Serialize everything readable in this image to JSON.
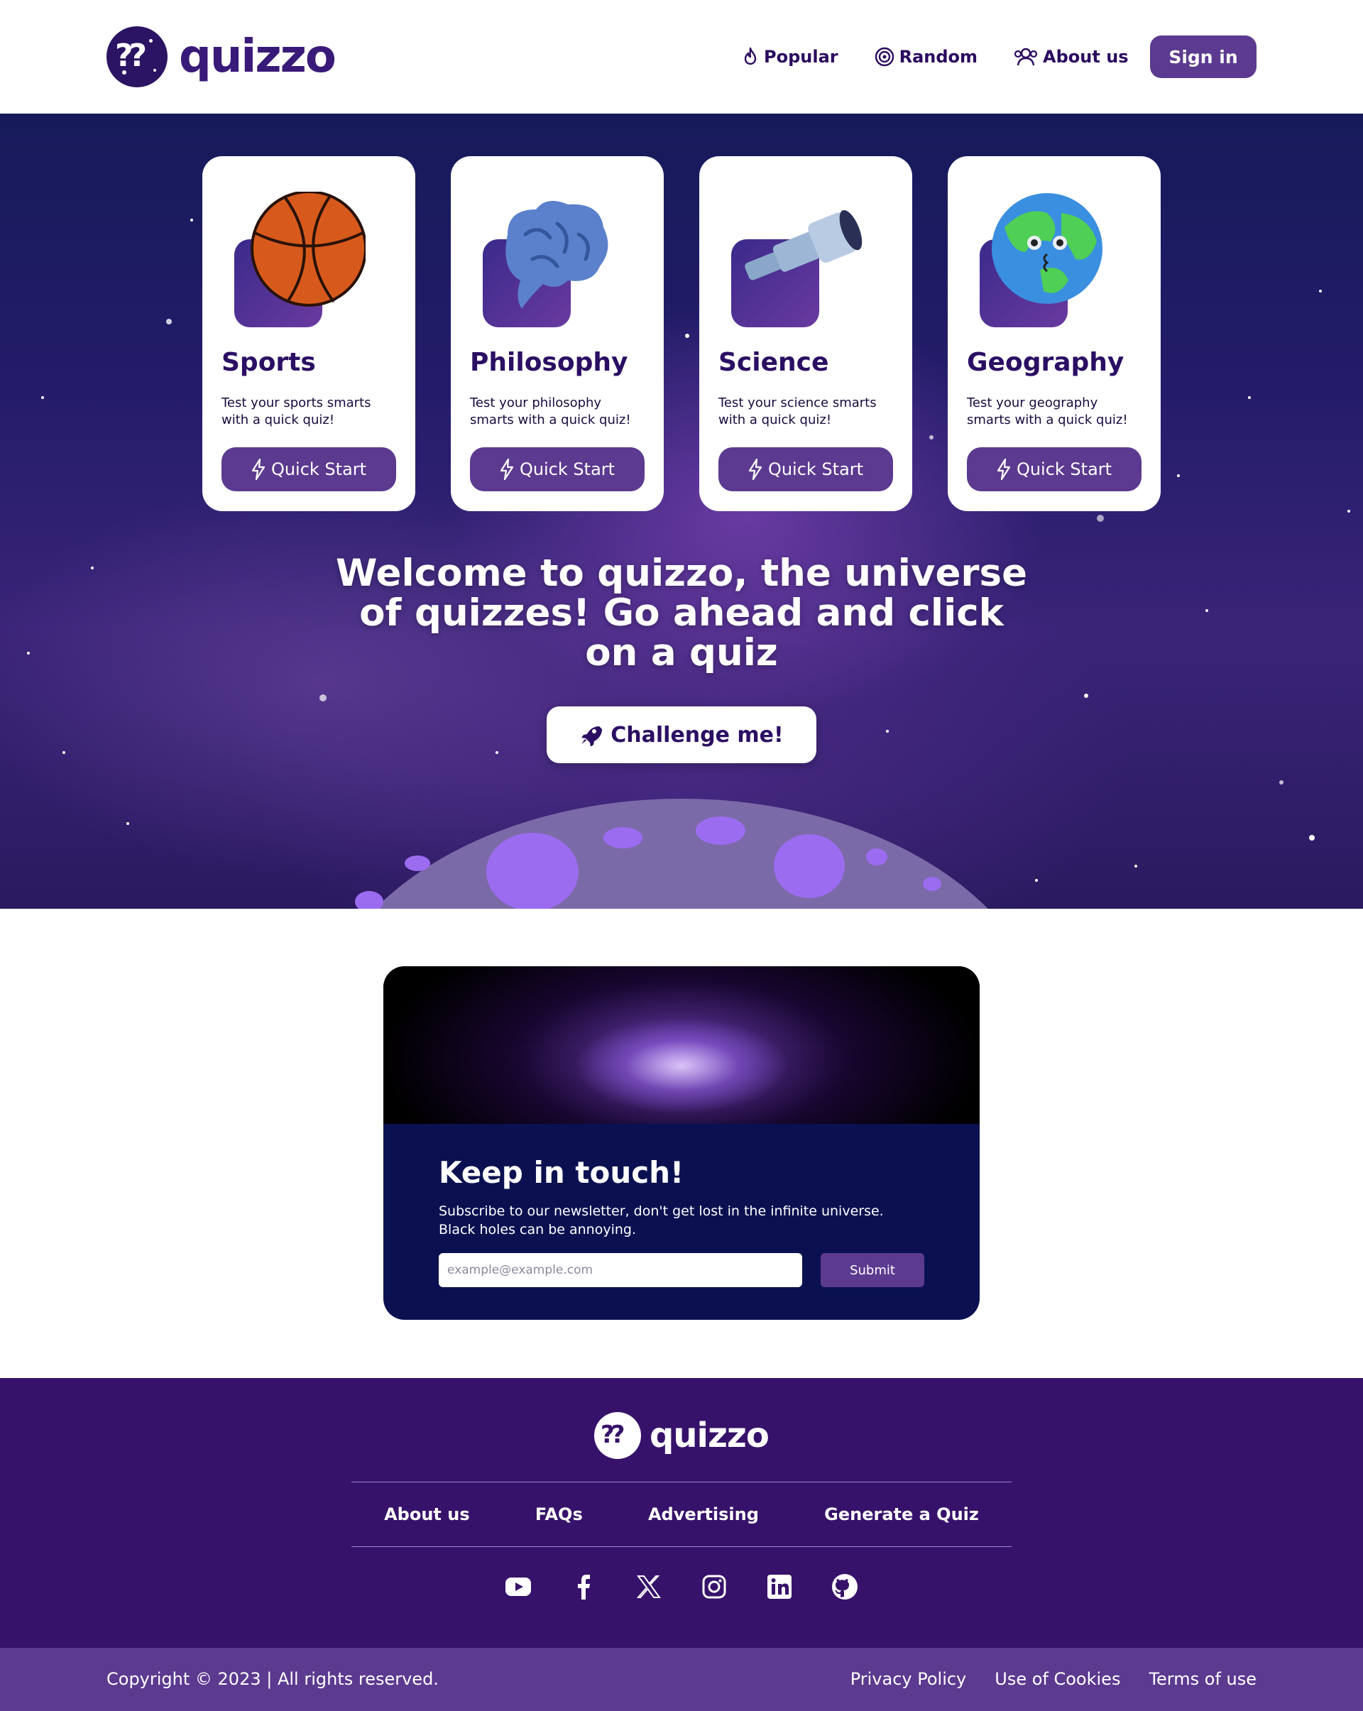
{
  "header": {
    "logo_text": "quizzo",
    "nav": {
      "popular": "Popular",
      "random": "Random",
      "about": "About us"
    },
    "signin_label": "Sign in"
  },
  "cards": [
    {
      "title": "Sports",
      "desc": "Test your sports smarts with a quick quiz!",
      "button": "Quick Start",
      "icon": "basketball-icon"
    },
    {
      "title": "Philosophy",
      "desc": "Test your philosophy smarts with a quick quiz!",
      "button": "Quick Start",
      "icon": "brain-icon"
    },
    {
      "title": "Science",
      "desc": "Test your science smarts with a quick quiz!",
      "button": "Quick Start",
      "icon": "telescope-icon"
    },
    {
      "title": "Geography",
      "desc": "Test your geography smarts with a quick quiz!",
      "button": "Quick Start",
      "icon": "globe-icon"
    }
  ],
  "hero": {
    "welcome_pre": "Welcome to ",
    "welcome_brand": "quizzo",
    "welcome_post": ", the universe of quizzes! Go ahead and click on a quiz",
    "challenge_label": "Challenge me!"
  },
  "newsletter": {
    "title": "Keep in touch!",
    "text": "Subscribe to our newsletter, don't get lost in the infinite universe. Black holes can be annoying.",
    "placeholder": "example@example.com",
    "submit_label": "Submit"
  },
  "footer": {
    "logo_text": "quizzo",
    "links": [
      "About us",
      "FAQs",
      "Advertising",
      "Generate a Quiz"
    ],
    "socials": [
      "youtube-icon",
      "facebook-icon",
      "x-icon",
      "instagram-icon",
      "linkedin-icon",
      "github-icon"
    ],
    "copyright": "Copyright © 2023 | All rights reserved.",
    "legal": [
      "Privacy Policy",
      "Use of Cookies",
      "Terms of use"
    ]
  },
  "colors": {
    "brand_purple": "#5c3a90",
    "dark_purple": "#37126a",
    "navy": "#0b1150",
    "text_dark": "#2a0a5e"
  }
}
